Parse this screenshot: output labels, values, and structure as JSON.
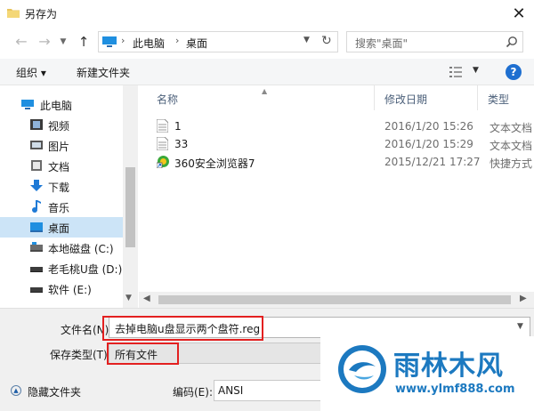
{
  "window": {
    "title": "另存为"
  },
  "address": {
    "crumbs": [
      "此电脑",
      "桌面"
    ],
    "separator": "›"
  },
  "search": {
    "placeholder": "搜索\"桌面\""
  },
  "toolbar": {
    "organize_label": "组织 ▾",
    "new_folder_label": "新建文件夹",
    "help_label": "?"
  },
  "nav": {
    "items": [
      {
        "label": "此电脑",
        "icon": "computer-icon"
      },
      {
        "label": "视频",
        "icon": "video-icon"
      },
      {
        "label": "图片",
        "icon": "picture-icon"
      },
      {
        "label": "文档",
        "icon": "document-icon"
      },
      {
        "label": "下载",
        "icon": "download-icon"
      },
      {
        "label": "音乐",
        "icon": "music-icon"
      },
      {
        "label": "桌面",
        "icon": "desktop-icon",
        "selected": true
      },
      {
        "label": "本地磁盘 (C:)",
        "icon": "drive-icon"
      },
      {
        "label": "老毛桃U盘 (D:)",
        "icon": "drive-icon"
      },
      {
        "label": "软件 (E:)",
        "icon": "drive-icon"
      }
    ]
  },
  "file_list": {
    "columns": [
      "名称",
      "修改日期",
      "类型"
    ],
    "rows": [
      {
        "name": "1",
        "date": "2016/1/20 15:26",
        "type": "文本文档",
        "icon": "text-file-icon"
      },
      {
        "name": "33",
        "date": "2016/1/20 15:29",
        "type": "文本文档",
        "icon": "text-file-icon"
      },
      {
        "name": "360安全浏览器7",
        "date": "2015/12/21 17:27",
        "type": "快捷方式",
        "icon": "shortcut-icon"
      }
    ]
  },
  "form": {
    "filename_label": "文件名(N):",
    "filename_value": "去掉电脑u盘显示两个盘符.reg",
    "filetype_label": "保存类型(T):",
    "filetype_value": "所有文件",
    "hide_folders_label": "隐藏文件夹",
    "encoding_label": "编码(E):",
    "encoding_value": "ANSI"
  },
  "watermark": {
    "title": "雨林木风",
    "url": "www.ylmf888.com"
  },
  "colors": {
    "accent": "#1e6fd0",
    "highlight": "#e32020",
    "selection": "#cce4f7",
    "watermark": "#1c79c0"
  }
}
